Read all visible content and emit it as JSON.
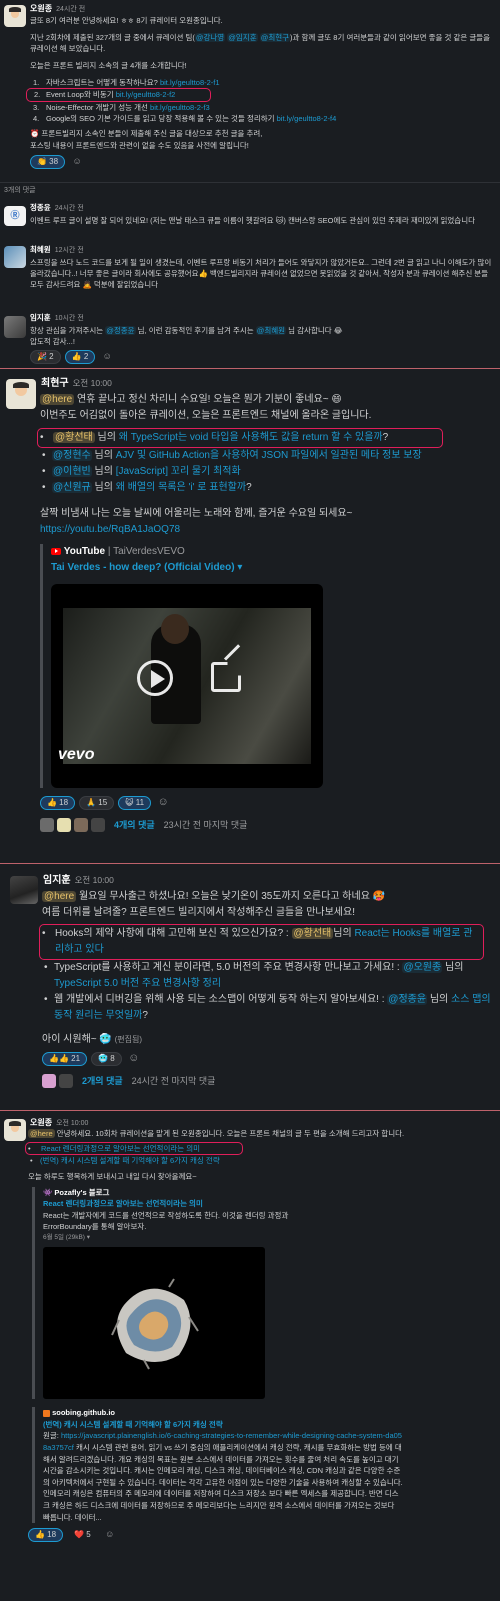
{
  "msg1": {
    "author": "오원종",
    "time": "24시간 전",
    "line1": "글또 8기 여러분 안녕하세요! ㅎㅎ 8기 큐레이터 오원종입니다.",
    "line2a": "지난 2회차에 제출된 327개의 글 중에서 큐레이션 팀(",
    "mention_a": "@강나영",
    "mention_b": "@임지훈",
    "mention_c": "@최현구",
    "line2b": ")과 함께 글또 8기 여러분들과 같이 읽어보면 좋을 것 같은 글들을 큐레이션 해 보았습니다.",
    "line3": "오늘은 프론트 빌리지 소속의 글 4개를 소개합니다!",
    "items": [
      {
        "num": "1.",
        "text": "자바스크립트는 어떻게 동작하나요?",
        "link": "bit.ly/geultto8-2-f1"
      },
      {
        "num": "2.",
        "text": "Event Loop와 비동기",
        "link": "bit.ly/geultto8-2-f2"
      },
      {
        "num": "3.",
        "text": "Noise-Effector 개발기 성능 개선",
        "link": "bit.ly/geultto8-2-f3"
      },
      {
        "num": "4.",
        "text": "Google의 SEO 기본 가이드를 읽고 당장 적용해 볼 수 있는 것들 정리하기",
        "link": "bit.ly/geultto8-2-f4"
      }
    ],
    "note1": "⏰ 프론트빌리지 소속인 분들이 제출해 주신 글을 대상으로 추천 글을 추려,",
    "note2": "포스팅 내용이 프론트엔드와 관련이 없을 수도 있음을 사전에 알립니다!",
    "reaction1": "👏 38"
  },
  "thread": {
    "count_label": "3개의 댓글",
    "replies": [
      {
        "author": "정종윤",
        "time": "24시간 전",
        "text": "이벤트 루프 글이 설명 잘 되어 있네요! (저는 맨날 태스크 큐들 이름이 헷갈려요 🐱) 캔버스랑 SEO에도 관심이 있던 주제라 재미있게 읽었습니다"
      },
      {
        "author": "최혜원",
        "time": "12시간 전",
        "text": "스프링을 쓰다 노드 코드를 보게 될 일이 생겼는데, 이벤트 루프랑 비동기 처리가 들어도 와닿지가 않았거든요.. 그런데 2번 글 읽고 나니 이해도가 많이 올라갔습니다..! 너무 좋은 글이라 회사에도 공유했어요👍 백엔드빌리지라 큐레이션 없었으면 못읽었을 것 같아서, 작성자 분과 큐레이션 해주신 분들 모두 감사드려요 🙇 덕분에 잘읽었습니다"
      },
      {
        "author": "임지훈",
        "time": "10시간 전",
        "text_a": "항상 관심을 가져주시는 ",
        "mention": "@정종윤",
        "text_b": " 님, 이런 감동적인 후기를 남겨 주시는 ",
        "mention2": "@최혜원",
        "text_c": " 님 감사합니다 😂",
        "text_d": "압도적 감사...!",
        "reactions": [
          "🎉 2",
          "👍 2"
        ]
      }
    ]
  },
  "msg2": {
    "author": "최현구",
    "time": "오전 10:00",
    "here": "@here",
    "line1": " 연휴 끝나고 정신 차리니 수요일! 오늘은 뭔가 기분이 좋네요~ 😄",
    "line2": "이번주도 어김없이 돌아온 큐레이션, 오늘은 프론트엔드 채널에 올라온 글입니다.",
    "items": [
      {
        "mention": "@황선태",
        "mid": " 님의 ",
        "link": "왜 TypeScript는 void 타입을 사용해도 값을 return 할 수 있을까",
        "end": "?"
      },
      {
        "mention": "@정현수",
        "mid": " 님의 ",
        "link": "AJV 및 GitHub Action을 사용하여 JSON 파일에서 일관된 메타 정보 보장",
        "end": ""
      },
      {
        "mention": "@이현빈",
        "mid": " 님의 ",
        "link": "[JavaScript] 꼬리 물기 최적화",
        "end": ""
      },
      {
        "mention": "@신원규",
        "mid": " 님의 ",
        "link": "왜 배열의 목록은 'i' 로 표현할까",
        "end": "?"
      }
    ],
    "line3": "살짝 비냄새 나는 오늘 날씨에 어울리는 노래와 함께, 즐거운 수요일 되세요~",
    "url": "https://youtu.be/RqBA1JaOQ78",
    "yt_brand": "YouTube",
    "yt_channel": "TaiVerdesVEVO",
    "yt_title": "Tai Verdes - how deep? (Official Video)",
    "vevo": "vevo",
    "reactions": [
      "👍 18",
      "🙏 15",
      "😺 11"
    ],
    "replies_label": "4개의 댓글",
    "last_reply": "23시간 전 마지막 댓글"
  },
  "msg3": {
    "author": "임지훈",
    "time": "오전 10:00",
    "here": "@here",
    "line1": " 월요일 무사출근 하셨나요! 오늘은 낮기온이 35도까지 오른다고 하네요 🥵",
    "line2": "여름 더위를 날려줄? 프론트엔드 빌리지에서 작성해주신 글들을 만나보세요!",
    "item1_a": "Hooks의 제약 사항에 대해 고민해 보신 적 있으신가요? : ",
    "item1_mention": "@황선태",
    "item1_mid": "님의 ",
    "item1_link": "React는 Hooks를 배열로 관리하고 있다",
    "item2_a": "TypeScript를 사용하고 계신 분이라면, 5.0 버전의 주요 변경사항 만나보고 가세요! : ",
    "item2_mention": "@오원종",
    "item2_mid": " 님의 ",
    "item2_link": "TypeScript 5.0 버전 주요 변경사항 정리",
    "item3_a": "웹 개발에서 디버깅을 위해 사용 되는 소스맵이 어떻게 동작 하는지 알아보세요! : ",
    "item3_mention": "@정종윤",
    "item3_mid": " 님의 ",
    "item3_link": "소스 맵의 동작 원리는 무엇일까",
    "item3_end": "?",
    "line3": "아이 시원해~ 🥶",
    "edited": "(편집됨)",
    "reactions": [
      "👍👍 21",
      "🥶 8"
    ],
    "replies_label": "2개의 댓글",
    "last_reply": "24시간 전 마지막 댓글"
  },
  "msg4": {
    "author": "오원종",
    "time": "오전 10:00",
    "here": "@here",
    "line1": " 안녕하세요. 10회차 큐레이션을 맡게 된 오원종입니다. 오늘은 프론트 채널의 글 두 편을 소개해 드리고자 합니다.",
    "item1": "React 렌더링과정으로 알아보는 선언적이라는 의미",
    "item2": "(번역) 캐시 시스템 설계할 때 기억해야 할 6가지 캐싱 전략",
    "line2": "오늘 하루도 행복하게 보내시고 내일 다시 찾아올께요~",
    "preview1": {
      "site": "👾 Pozafly's 블로그",
      "title": "React 렌더링과정으로 알아보는 선언적이라는 의미",
      "desc": "React는 개발자에게 코드를 선언적으로 작성하도록 한다. 이것을 렌더링 과정과 ErrorBoundary를 통해 알아보자.",
      "meta": "6월 5일 (29kB) ▾"
    },
    "preview2": {
      "site": "soobing.github.io",
      "title": "(번역) 캐시 시스템 설계할 때 기억해야 할 6가지 캐싱 전략",
      "orig_label": "원글: ",
      "orig_url": "https://javascript.plainenglish.io/6-caching-strategies-to-remember-while-designing-cache-system-da058a3757cf",
      "desc": " 캐시 시스템 관련 용어, 읽기 vs 쓰기 중심의 애플리케이션에서 캐싱 전략, 캐시를 무효화하는 방법 등에 대해서 알려드리겠습니다. 개요 캐싱의 목표는 원본 소스에서 데이터를 가져오는 횟수를 줄여 처리 속도를 높이고 대기 시간을 감소시키는 것입니다. 캐시는 인메모리 캐싱, 디스크 캐싱, 데이터베이스 캐싱, CDN 캐싱과 같은 다양한 수준의 아키텍처에서 구현될 수 있습니다. 데이터는 각각 고유한 이점이 있는 다양한 기술을 사용하여 캐싱할 수 있습니다. 인메모리 캐싱은 컴퓨터의 주 메모리에 데이터를 저장하여 디스크 저장소 보다 빠른 엑세스를 제공합니다. 반면 디스크 캐싱은 하드 디스크에 데이터를 저장하므로 주 메모리보다는 느리지만 원격 소스에서 데이터를 가져오는 것보다 빠릅니다. 데이터..."
    },
    "reactions": [
      "👍 18",
      "❤️ 5"
    ]
  }
}
